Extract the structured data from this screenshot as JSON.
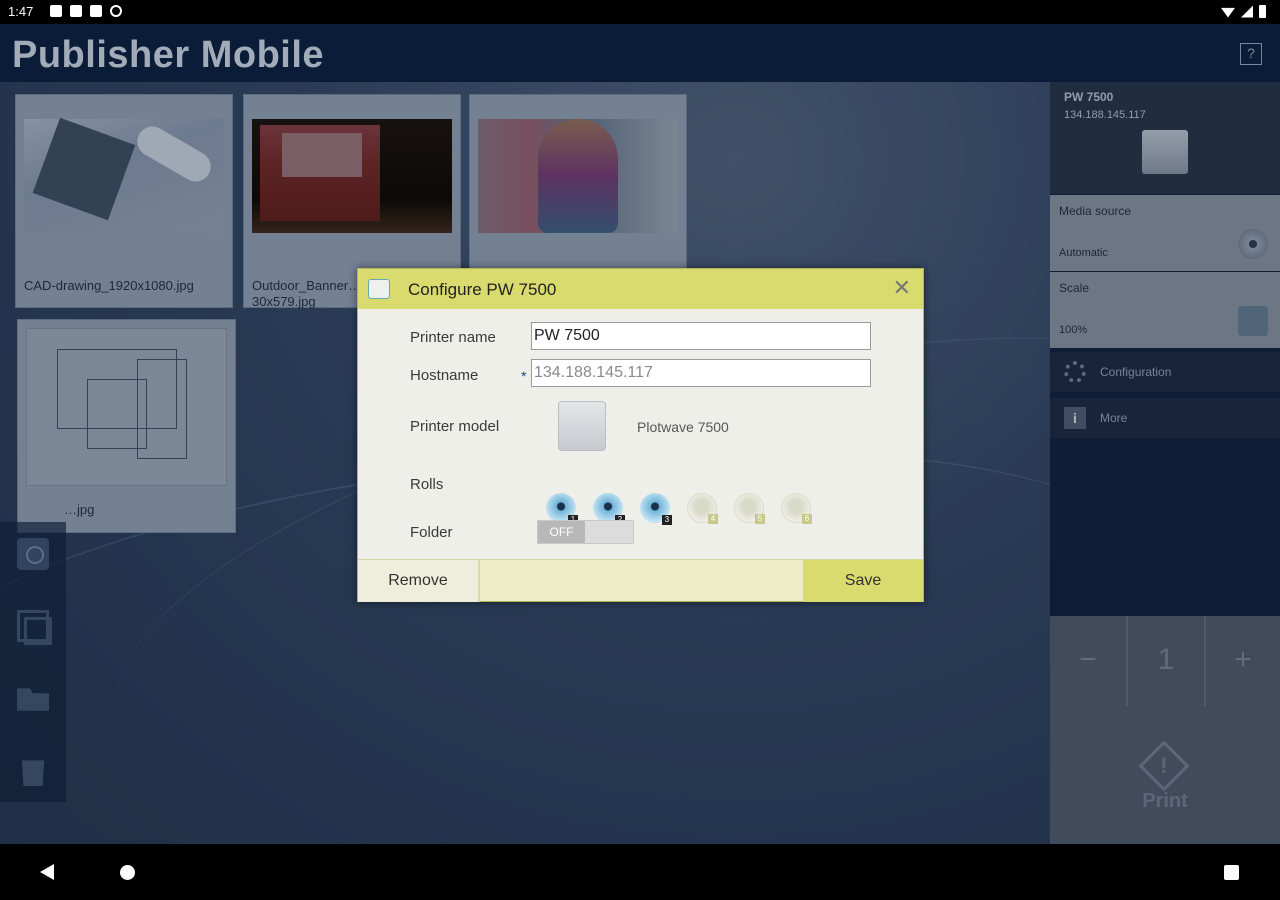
{
  "status": {
    "time": "1:47"
  },
  "app": {
    "title": "Publisher Mobile",
    "help_label": "?"
  },
  "thumbnails": [
    {
      "caption": "CAD-drawing_1920x1080.jpg"
    },
    {
      "caption": "Outdoor_Banner…\n30x579.jpg"
    },
    {
      "caption": ""
    },
    {
      "caption": "…jpg"
    }
  ],
  "right_panel": {
    "printer_name": "PW 7500",
    "printer_ip": "134.188.145.117",
    "media_source": {
      "label": "Media source",
      "value": "Automatic"
    },
    "scale": {
      "label": "Scale",
      "value": "100%"
    },
    "configuration_label": "Configuration",
    "more_label": "More",
    "quantity": {
      "minus": "−",
      "value": "1",
      "plus": "+"
    },
    "print_label": "Print"
  },
  "dialog": {
    "title": "Configure PW 7500",
    "close_label": "✕",
    "printer_name_label": "Printer name",
    "printer_name_value": "PW 7500",
    "hostname_label": "Hostname",
    "hostname_required": "*",
    "hostname_value": "134.188.145.117",
    "printer_model_label": "Printer model",
    "printer_model_value": "Plotwave 7500",
    "rolls_label": "Rolls",
    "rolls": [
      {
        "number": "1",
        "active": true
      },
      {
        "number": "2",
        "active": true
      },
      {
        "number": "3",
        "active": true
      },
      {
        "number": "4",
        "active": false
      },
      {
        "number": "5",
        "active": false
      },
      {
        "number": "6",
        "active": false
      }
    ],
    "folder_label": "Folder",
    "folder_toggle": "OFF",
    "remove_label": "Remove",
    "save_label": "Save"
  }
}
